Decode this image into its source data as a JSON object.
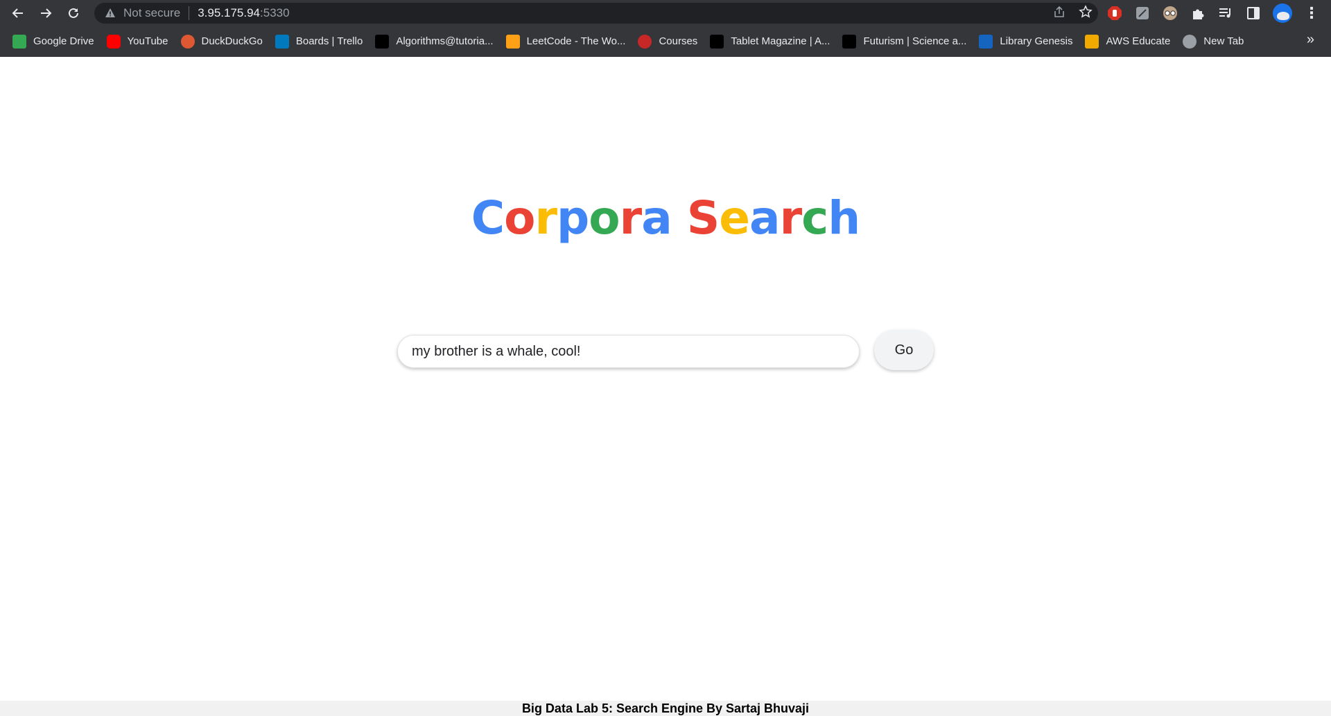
{
  "browser": {
    "address": {
      "security_label": "Not secure",
      "host": "3.95.175.94",
      "port": ":5330"
    },
    "bookmarks": [
      {
        "label": "Google Drive",
        "icon": "google-drive-icon",
        "color": "#34a853"
      },
      {
        "label": "YouTube",
        "icon": "youtube-icon",
        "color": "#ff0000"
      },
      {
        "label": "DuckDuckGo",
        "icon": "duckduckgo-icon",
        "color": "#de5833"
      },
      {
        "label": "Boards | Trello",
        "icon": "trello-icon",
        "color": "#0079bf"
      },
      {
        "label": "Algorithms@tutoria...",
        "icon": "tutorialhorizon-icon",
        "color": "#000000"
      },
      {
        "label": "LeetCode - The Wo...",
        "icon": "leetcode-icon",
        "color": "#ffa116"
      },
      {
        "label": "Courses",
        "icon": "courses-icon",
        "color": "#c62828"
      },
      {
        "label": "Tablet Magazine | A...",
        "icon": "tablet-magazine-icon",
        "color": "#000000"
      },
      {
        "label": "Futurism | Science a...",
        "icon": "futurism-icon",
        "color": "#000000"
      },
      {
        "label": "Library Genesis",
        "icon": "library-genesis-icon",
        "color": "#1565c0"
      },
      {
        "label": "AWS Educate",
        "icon": "aws-educate-icon",
        "color": "#f2a900"
      },
      {
        "label": "New Tab",
        "icon": "globe-icon",
        "color": "#9aa0a6"
      }
    ],
    "more_bookmarks": "»"
  },
  "page": {
    "logo_letters": [
      {
        "char": "C",
        "color": "#4285f4"
      },
      {
        "char": "o",
        "color": "#ea4335"
      },
      {
        "char": "r",
        "color": "#fbbc05"
      },
      {
        "char": "p",
        "color": "#4285f4"
      },
      {
        "char": "o",
        "color": "#34a853"
      },
      {
        "char": "r",
        "color": "#ea4335"
      },
      {
        "char": "a",
        "color": "#4285f4"
      },
      {
        "char": " ",
        "color": "#000000"
      },
      {
        "char": "S",
        "color": "#ea4335"
      },
      {
        "char": "e",
        "color": "#fbbc05"
      },
      {
        "char": "a",
        "color": "#4285f4"
      },
      {
        "char": "r",
        "color": "#ea4335"
      },
      {
        "char": "c",
        "color": "#34a853"
      },
      {
        "char": "h",
        "color": "#4285f4"
      }
    ],
    "search_value": "my brother is a whale, cool!",
    "go_label": "Go",
    "footer": "Big Data Lab 5: Search Engine By Sartaj Bhuvaji"
  }
}
